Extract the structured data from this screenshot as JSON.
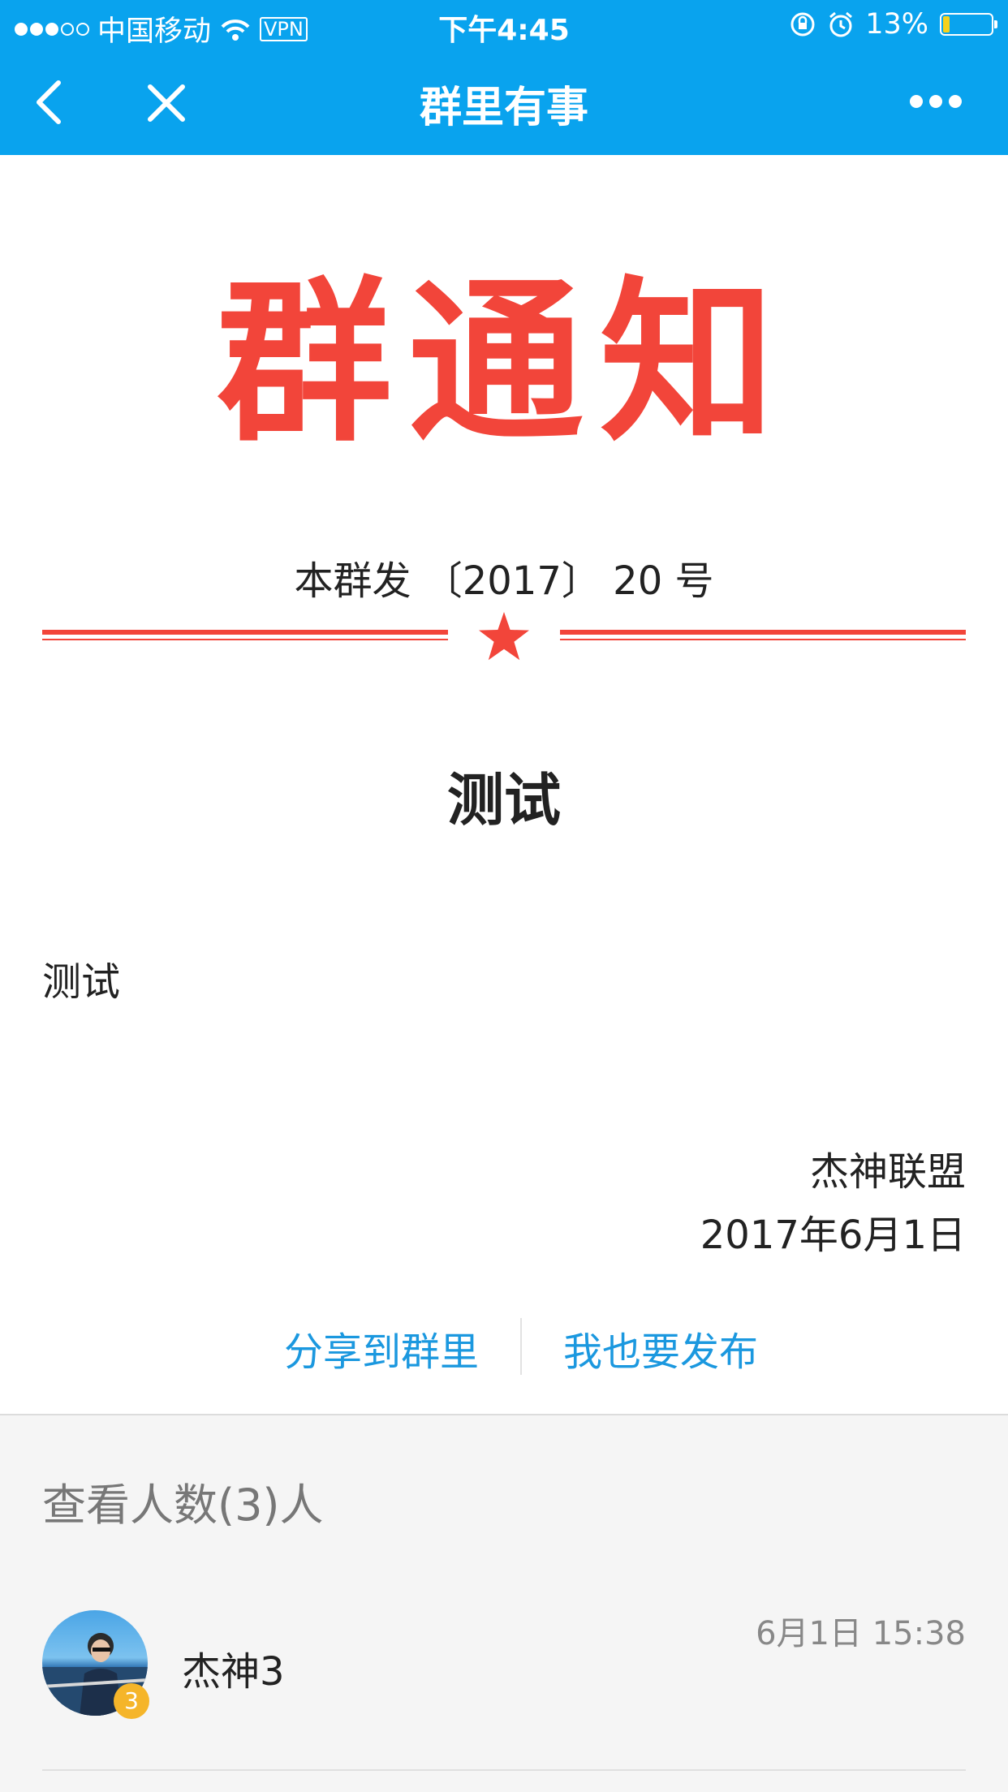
{
  "status_bar": {
    "carrier": "中国移动",
    "vpn": "VPN",
    "time": "下午4:45",
    "battery": "13%",
    "signal_bars": 3,
    "battery_level": 0.13
  },
  "nav": {
    "title": "群里有事",
    "back_icon": "chevron-left-icon",
    "close_icon": "close-icon",
    "more_icon": "more-icon"
  },
  "notice": {
    "header": "群通知",
    "doc_number": "本群发 〔2017〕 20 号",
    "subject": "测试",
    "body": "测试",
    "signature": "杰神联盟",
    "date": "2017年6月1日",
    "accent_color": "#f2453a"
  },
  "actions": {
    "share": "分享到群里",
    "publish": "我也要发布",
    "link_color": "#1b98df"
  },
  "viewers": {
    "count_label": "查看人数(3)人",
    "items": [
      {
        "name": "杰神3",
        "time": "6月1日 15:38",
        "badge": "3"
      }
    ]
  },
  "theme": {
    "nav_color": "#09a3ee"
  }
}
